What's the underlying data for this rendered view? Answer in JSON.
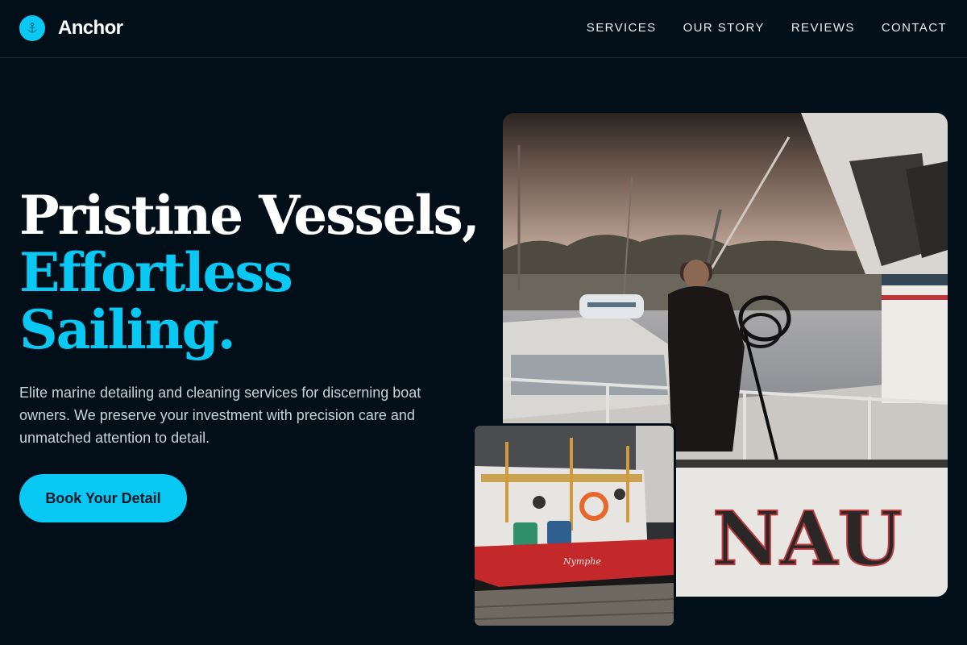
{
  "brand": {
    "name": "Anchor",
    "icon": "anchor-icon",
    "accent_color": "#09c9f4"
  },
  "nav": {
    "items": [
      {
        "label": "SERVICES"
      },
      {
        "label": "OUR STORY"
      },
      {
        "label": "REVIEWS"
      },
      {
        "label": "CONTACT"
      }
    ]
  },
  "hero": {
    "headline_line1": "Pristine Vessels,",
    "headline_line2": "Effortless",
    "headline_line3": "Sailing.",
    "description": "Elite marine detailing and cleaning services for discerning boat owners. We preserve your investment with precision care and unmatched attention to detail.",
    "cta_label": "Book Your Detail"
  },
  "images": {
    "main": {
      "subject": "man coiling a rope on a white boat in a marina",
      "hull_text": "NAU"
    },
    "secondary": {
      "subject": "red and white fishing boat docked at a pier",
      "boat_name": "Nymphe"
    }
  }
}
